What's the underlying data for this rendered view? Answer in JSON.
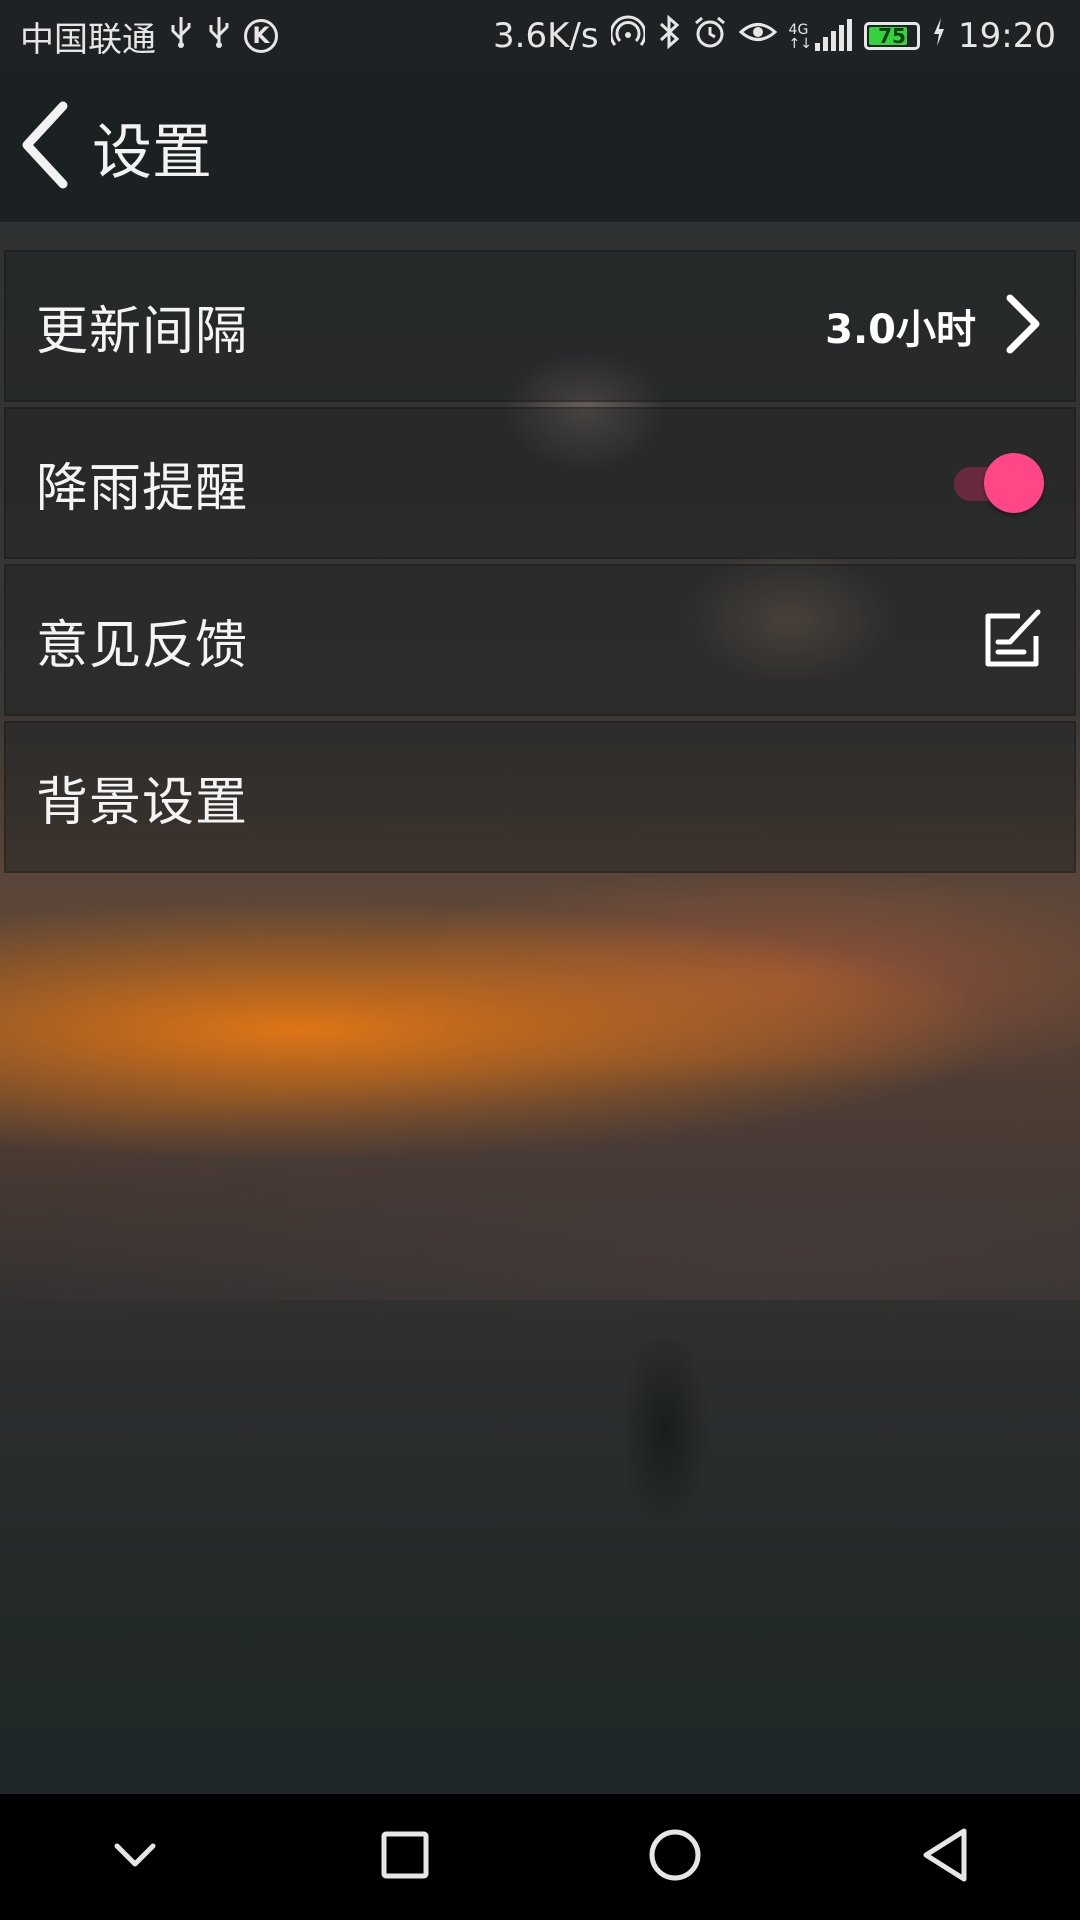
{
  "status_bar": {
    "carrier": "中国联通",
    "network_speed": "3.6K/s",
    "battery_level": "75",
    "time": "19:20",
    "icons": [
      "usb-icon",
      "usb-icon",
      "k-icon",
      "hotspot-icon",
      "bluetooth-icon",
      "alarm-icon",
      "eye-icon",
      "4g-signal-icon",
      "battery-icon",
      "charging-icon"
    ]
  },
  "header": {
    "title": "设置"
  },
  "settings": {
    "update_interval": {
      "label": "更新间隔",
      "value": "3.0小时"
    },
    "rain_alert": {
      "label": "降雨提醒",
      "enabled": true
    },
    "feedback": {
      "label": "意见反馈"
    },
    "background": {
      "label": "背景设置"
    }
  },
  "colors": {
    "accent": "#ff4787",
    "battery_fill": "#35d240"
  }
}
